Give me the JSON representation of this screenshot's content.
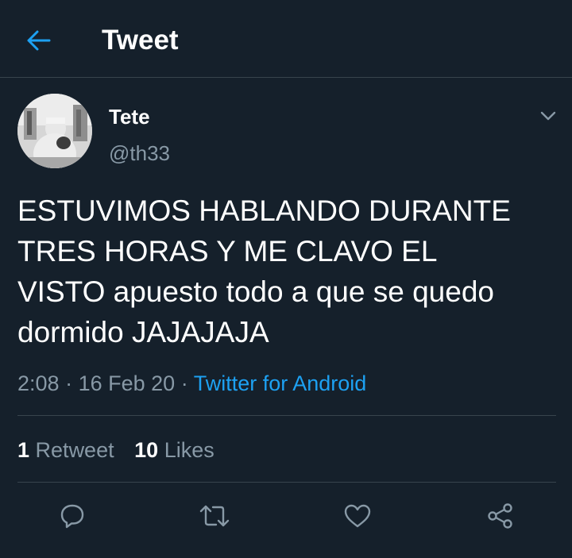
{
  "header": {
    "title": "Tweet",
    "back_icon": "arrow-left-icon"
  },
  "tweet": {
    "author": {
      "display_name": "Tete",
      "handle": "@th33"
    },
    "text": "ESTUVIMOS HABLANDO DURANTE\nTRES HORAS Y ME CLAVO EL\nVISTO apuesto todo a que se quedo\ndormido JAJAJAJA",
    "time": "2:08",
    "date": "16 Feb 20",
    "separator": "·",
    "source": "Twitter for Android"
  },
  "stats": {
    "retweets_count": "1",
    "retweets_label": "Retweet",
    "likes_count": "10",
    "likes_label": "Likes"
  },
  "actions": [
    "reply-icon",
    "retweet-icon",
    "like-icon",
    "share-icon"
  ],
  "colors": {
    "background": "#15202b",
    "accent": "#1da1f2",
    "secondary_text": "#8899a6",
    "divider": "#38444d"
  }
}
